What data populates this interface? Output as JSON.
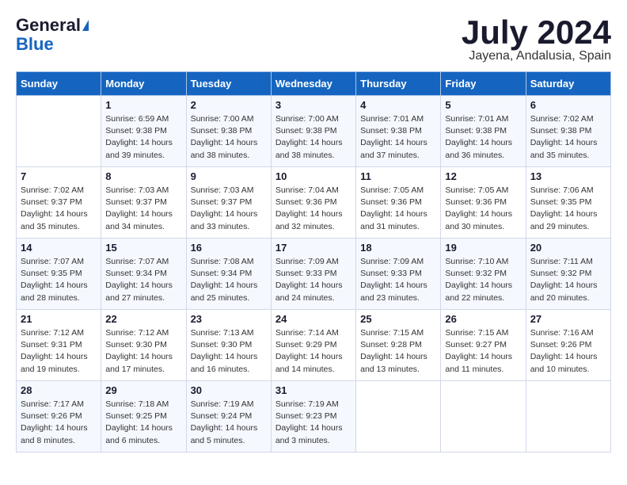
{
  "logo": {
    "general": "General",
    "blue": "Blue"
  },
  "title": "July 2024",
  "location": "Jayena, Andalusia, Spain",
  "days_header": [
    "Sunday",
    "Monday",
    "Tuesday",
    "Wednesday",
    "Thursday",
    "Friday",
    "Saturday"
  ],
  "weeks": [
    [
      {
        "day": "",
        "sunrise": "",
        "sunset": "",
        "daylight": ""
      },
      {
        "day": "1",
        "sunrise": "Sunrise: 6:59 AM",
        "sunset": "Sunset: 9:38 PM",
        "daylight": "Daylight: 14 hours and 39 minutes."
      },
      {
        "day": "2",
        "sunrise": "Sunrise: 7:00 AM",
        "sunset": "Sunset: 9:38 PM",
        "daylight": "Daylight: 14 hours and 38 minutes."
      },
      {
        "day": "3",
        "sunrise": "Sunrise: 7:00 AM",
        "sunset": "Sunset: 9:38 PM",
        "daylight": "Daylight: 14 hours and 38 minutes."
      },
      {
        "day": "4",
        "sunrise": "Sunrise: 7:01 AM",
        "sunset": "Sunset: 9:38 PM",
        "daylight": "Daylight: 14 hours and 37 minutes."
      },
      {
        "day": "5",
        "sunrise": "Sunrise: 7:01 AM",
        "sunset": "Sunset: 9:38 PM",
        "daylight": "Daylight: 14 hours and 36 minutes."
      },
      {
        "day": "6",
        "sunrise": "Sunrise: 7:02 AM",
        "sunset": "Sunset: 9:38 PM",
        "daylight": "Daylight: 14 hours and 35 minutes."
      }
    ],
    [
      {
        "day": "7",
        "sunrise": "Sunrise: 7:02 AM",
        "sunset": "Sunset: 9:37 PM",
        "daylight": "Daylight: 14 hours and 35 minutes."
      },
      {
        "day": "8",
        "sunrise": "Sunrise: 7:03 AM",
        "sunset": "Sunset: 9:37 PM",
        "daylight": "Daylight: 14 hours and 34 minutes."
      },
      {
        "day": "9",
        "sunrise": "Sunrise: 7:03 AM",
        "sunset": "Sunset: 9:37 PM",
        "daylight": "Daylight: 14 hours and 33 minutes."
      },
      {
        "day": "10",
        "sunrise": "Sunrise: 7:04 AM",
        "sunset": "Sunset: 9:36 PM",
        "daylight": "Daylight: 14 hours and 32 minutes."
      },
      {
        "day": "11",
        "sunrise": "Sunrise: 7:05 AM",
        "sunset": "Sunset: 9:36 PM",
        "daylight": "Daylight: 14 hours and 31 minutes."
      },
      {
        "day": "12",
        "sunrise": "Sunrise: 7:05 AM",
        "sunset": "Sunset: 9:36 PM",
        "daylight": "Daylight: 14 hours and 30 minutes."
      },
      {
        "day": "13",
        "sunrise": "Sunrise: 7:06 AM",
        "sunset": "Sunset: 9:35 PM",
        "daylight": "Daylight: 14 hours and 29 minutes."
      }
    ],
    [
      {
        "day": "14",
        "sunrise": "Sunrise: 7:07 AM",
        "sunset": "Sunset: 9:35 PM",
        "daylight": "Daylight: 14 hours and 28 minutes."
      },
      {
        "day": "15",
        "sunrise": "Sunrise: 7:07 AM",
        "sunset": "Sunset: 9:34 PM",
        "daylight": "Daylight: 14 hours and 27 minutes."
      },
      {
        "day": "16",
        "sunrise": "Sunrise: 7:08 AM",
        "sunset": "Sunset: 9:34 PM",
        "daylight": "Daylight: 14 hours and 25 minutes."
      },
      {
        "day": "17",
        "sunrise": "Sunrise: 7:09 AM",
        "sunset": "Sunset: 9:33 PM",
        "daylight": "Daylight: 14 hours and 24 minutes."
      },
      {
        "day": "18",
        "sunrise": "Sunrise: 7:09 AM",
        "sunset": "Sunset: 9:33 PM",
        "daylight": "Daylight: 14 hours and 23 minutes."
      },
      {
        "day": "19",
        "sunrise": "Sunrise: 7:10 AM",
        "sunset": "Sunset: 9:32 PM",
        "daylight": "Daylight: 14 hours and 22 minutes."
      },
      {
        "day": "20",
        "sunrise": "Sunrise: 7:11 AM",
        "sunset": "Sunset: 9:32 PM",
        "daylight": "Daylight: 14 hours and 20 minutes."
      }
    ],
    [
      {
        "day": "21",
        "sunrise": "Sunrise: 7:12 AM",
        "sunset": "Sunset: 9:31 PM",
        "daylight": "Daylight: 14 hours and 19 minutes."
      },
      {
        "day": "22",
        "sunrise": "Sunrise: 7:12 AM",
        "sunset": "Sunset: 9:30 PM",
        "daylight": "Daylight: 14 hours and 17 minutes."
      },
      {
        "day": "23",
        "sunrise": "Sunrise: 7:13 AM",
        "sunset": "Sunset: 9:30 PM",
        "daylight": "Daylight: 14 hours and 16 minutes."
      },
      {
        "day": "24",
        "sunrise": "Sunrise: 7:14 AM",
        "sunset": "Sunset: 9:29 PM",
        "daylight": "Daylight: 14 hours and 14 minutes."
      },
      {
        "day": "25",
        "sunrise": "Sunrise: 7:15 AM",
        "sunset": "Sunset: 9:28 PM",
        "daylight": "Daylight: 14 hours and 13 minutes."
      },
      {
        "day": "26",
        "sunrise": "Sunrise: 7:15 AM",
        "sunset": "Sunset: 9:27 PM",
        "daylight": "Daylight: 14 hours and 11 minutes."
      },
      {
        "day": "27",
        "sunrise": "Sunrise: 7:16 AM",
        "sunset": "Sunset: 9:26 PM",
        "daylight": "Daylight: 14 hours and 10 minutes."
      }
    ],
    [
      {
        "day": "28",
        "sunrise": "Sunrise: 7:17 AM",
        "sunset": "Sunset: 9:26 PM",
        "daylight": "Daylight: 14 hours and 8 minutes."
      },
      {
        "day": "29",
        "sunrise": "Sunrise: 7:18 AM",
        "sunset": "Sunset: 9:25 PM",
        "daylight": "Daylight: 14 hours and 6 minutes."
      },
      {
        "day": "30",
        "sunrise": "Sunrise: 7:19 AM",
        "sunset": "Sunset: 9:24 PM",
        "daylight": "Daylight: 14 hours and 5 minutes."
      },
      {
        "day": "31",
        "sunrise": "Sunrise: 7:19 AM",
        "sunset": "Sunset: 9:23 PM",
        "daylight": "Daylight: 14 hours and 3 minutes."
      },
      {
        "day": "",
        "sunrise": "",
        "sunset": "",
        "daylight": ""
      },
      {
        "day": "",
        "sunrise": "",
        "sunset": "",
        "daylight": ""
      },
      {
        "day": "",
        "sunrise": "",
        "sunset": "",
        "daylight": ""
      }
    ]
  ]
}
